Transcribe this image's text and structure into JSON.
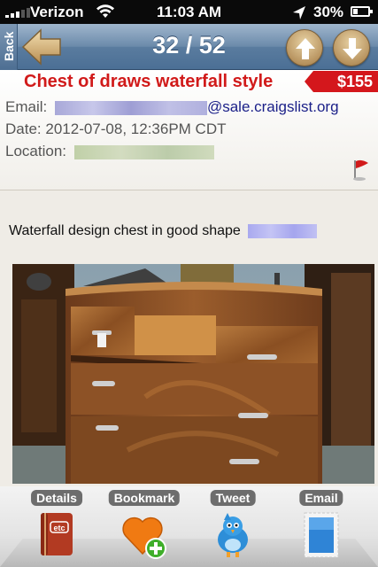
{
  "status_bar": {
    "carrier": "Verizon",
    "time": "11:03 AM",
    "battery_percent": "30%"
  },
  "nav": {
    "back_label": "Back",
    "counter": "32 / 52",
    "icons": {
      "back": "arrow-left-icon",
      "prev": "arrow-up-icon",
      "next": "arrow-down-icon"
    }
  },
  "listing": {
    "title": "Chest of draws waterfall style",
    "price": "$155",
    "email_label": "Email:",
    "email_domain": "@sale.craigslist.org",
    "date_label": "Date:",
    "date_value": "2012-07-08, 12:36PM CDT",
    "location_label": "Location:",
    "description": "Waterfall design chest in good shape"
  },
  "toolbar": {
    "items": [
      {
        "label": "Details",
        "icon": "details-book-icon"
      },
      {
        "label": "Bookmark",
        "icon": "bookmark-heart-icon"
      },
      {
        "label": "Tweet",
        "icon": "twitter-bird-icon"
      },
      {
        "label": "Email",
        "icon": "email-stamp-icon"
      }
    ]
  },
  "colors": {
    "title_red": "#d11a1a",
    "email_blue": "#1a1f88",
    "nav_blue": "#5a7c9f",
    "price_tag": "#d4171c"
  }
}
